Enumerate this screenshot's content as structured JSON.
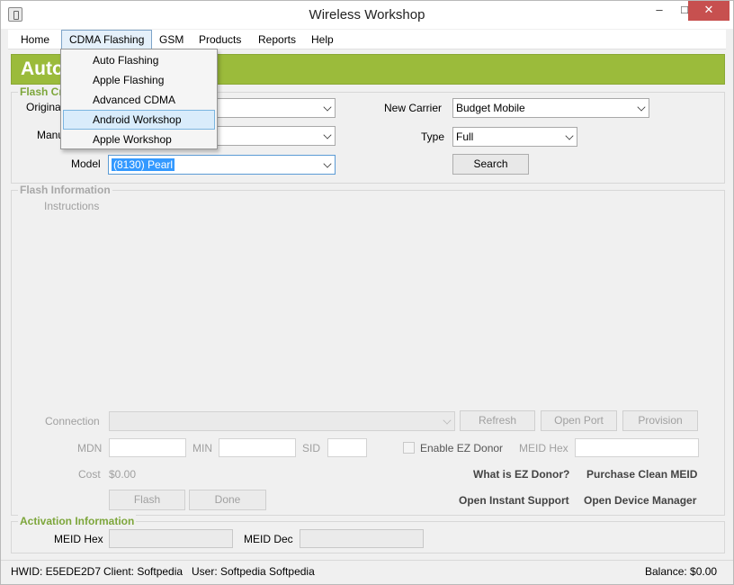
{
  "window": {
    "title": "Wireless Workshop",
    "minimize": "–",
    "maximize": "□",
    "close": "✕"
  },
  "menubar": {
    "items": [
      "Home",
      "CDMA Flashing",
      "GSM",
      "Products",
      "Reports",
      "Help"
    ]
  },
  "dropdown": {
    "items": [
      "Auto Flashing",
      "Apple Flashing",
      "Advanced CDMA",
      "Android Workshop",
      "Apple Workshop"
    ],
    "highlighted": "Android Workshop"
  },
  "banner": {
    "text": "Auto"
  },
  "flash_criteria": {
    "label": "Flash Cr",
    "original_label": "Origina",
    "manufacturer_label": "Manu",
    "model_label": "Model",
    "model_value": "(8130) Pearl",
    "new_carrier_label": "New Carrier",
    "new_carrier_value": "Budget Mobile",
    "type_label": "Type",
    "type_value": "Full",
    "search_button": "Search"
  },
  "flash_info": {
    "label": "Flash Information",
    "instructions": "Instructions",
    "connection_label": "Connection",
    "refresh_button": "Refresh",
    "open_port_button": "Open Port",
    "provision_button": "Provision",
    "mdn_label": "MDN",
    "min_label": "MIN",
    "sid_label": "SID",
    "ez_donor_label": "Enable EZ Donor",
    "meid_hex_label": "MEID Hex",
    "cost_label": "Cost",
    "cost_value": "$0.00",
    "what_is_ez_donor": "What is EZ Donor?",
    "purchase_clean_meid": "Purchase Clean MEID",
    "flash_button": "Flash",
    "done_button": "Done",
    "open_instant_support": "Open Instant Support",
    "open_device_manager": "Open Device Manager"
  },
  "activation": {
    "label": "Activation Information",
    "meid_hex_label": "MEID Hex",
    "meid_dec_label": "MEID Dec"
  },
  "status": {
    "hwid": "HWID: E5EDE2D7",
    "client": "Client: Softpedia",
    "user": "User: Softpedia Softpedia",
    "balance": "Balance: $0.00"
  },
  "colors": {
    "banner": "#9bbb3b",
    "group_label_green": "#7da63b",
    "highlight": "#3399ff",
    "close_button": "#c7504f"
  }
}
